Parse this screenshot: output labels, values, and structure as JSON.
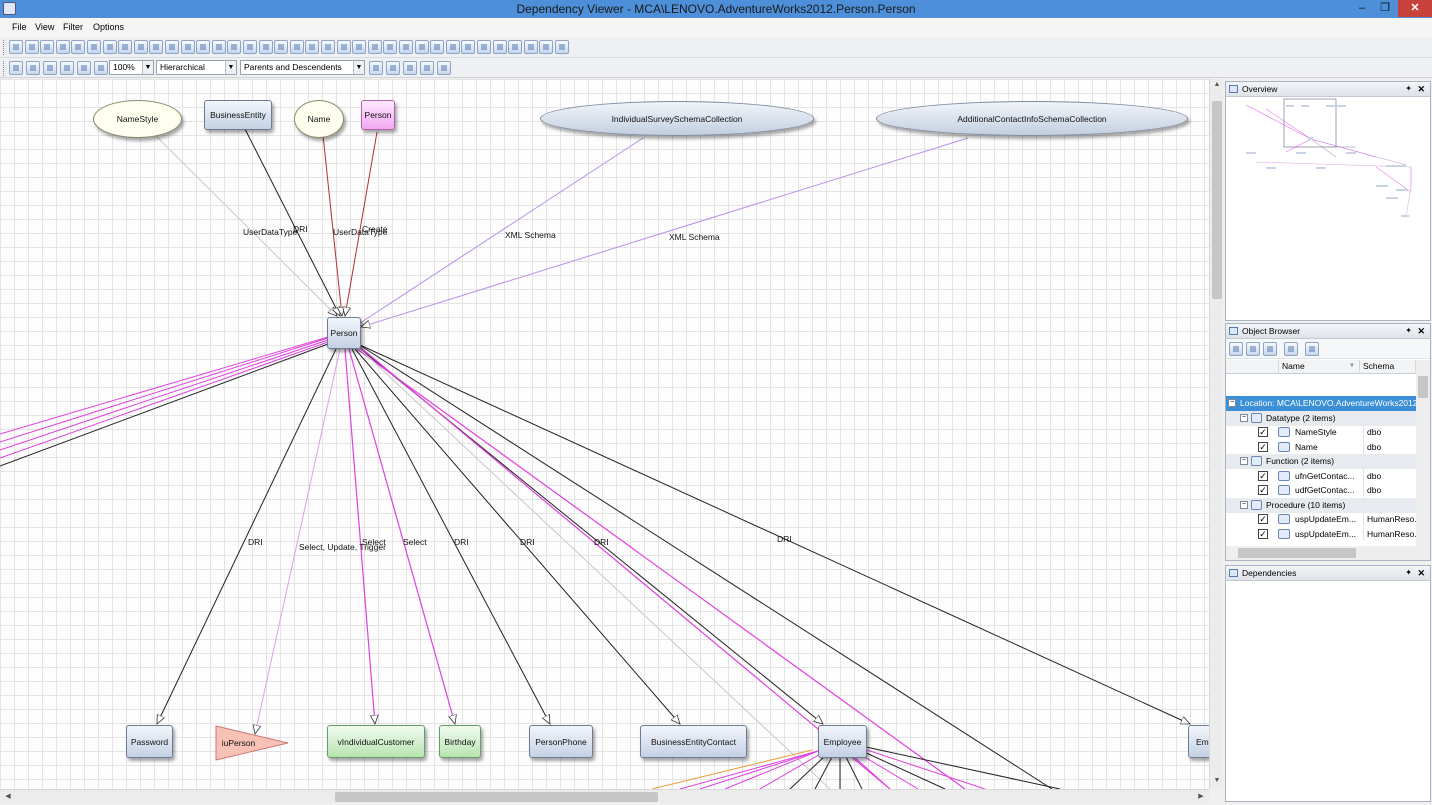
{
  "window": {
    "title": "Dependency Viewer - MCA\\LENOVO.AdventureWorks2012.Person.Person",
    "minimize": "–",
    "maximize": "❐",
    "close": "✕"
  },
  "menu": [
    "File",
    "View",
    "Filter",
    "Options"
  ],
  "toolbar2": {
    "zoom": "100%",
    "layout": "Hierarchical",
    "mode": "Parents and Descendents"
  },
  "graph": {
    "nodes": {
      "namestyle": "NameStyle",
      "business_entity": "BusinessEntity",
      "name": "Name",
      "person_top": "Person",
      "individual_survey": "IndividualSurveySchemaCollection",
      "additional_contact": "AdditionalContactInfoSchemaCollection",
      "person_center": "Person",
      "password": "Password",
      "iuperson": "iuPerson",
      "vindividualcustomer": "vIndividualCustomer",
      "birthday": "Birthday",
      "personphone": "PersonPhone",
      "businessentitycontact": "BusinessEntityContact",
      "employee": "Employee",
      "emailaddress_partial": "Ema"
    },
    "edge_labels": {
      "userdatatype_1": "UserDataType",
      "dri_1": "DRI",
      "userdatatype_2": "UserDataType",
      "create": "Create",
      "xml_schema_1": "XML Schema",
      "xml_schema_2": "XML Schema",
      "dri_password": "DRI",
      "select_update_trigger": "Select, Update, Trigger",
      "select_1": "Select",
      "select_2": "Select",
      "dri_personphone": "DRI",
      "dri_bec": "DRI",
      "dri_employee": "DRI",
      "dri_email": "DRI"
    }
  },
  "panels": {
    "overview": "Overview",
    "object_browser": "Object Browser",
    "dependencies": "Dependencies",
    "pin": "✦",
    "close": "✕"
  },
  "object_browser": {
    "col_name": "Name",
    "col_schema": "Schema",
    "location": "Location:  MCA\\LENOVO.AdventureWorks2012...",
    "groups": [
      {
        "label": "Datatype (2 items)",
        "rows": [
          {
            "name": "NameStyle",
            "schema": "dbo"
          },
          {
            "name": "Name",
            "schema": "dbo"
          }
        ]
      },
      {
        "label": "Function (2 items)",
        "rows": [
          {
            "name": "ufnGetContac...",
            "schema": "dbo"
          },
          {
            "name": "udfGetContac...",
            "schema": "dbo"
          }
        ]
      },
      {
        "label": "Procedure (10 items)",
        "rows": [
          {
            "name": "uspUpdateEm...",
            "schema": "HumanReso..."
          },
          {
            "name": "uspUpdateEm...",
            "schema": "HumanReso..."
          }
        ]
      }
    ]
  },
  "colors": {
    "titlebar": "#4d8fd8",
    "selection": "#3a8fd6",
    "edge_black": "#222222",
    "edge_magenta": "#e040e0",
    "edge_violet": "#b890e8",
    "edge_red": "#b03030"
  }
}
